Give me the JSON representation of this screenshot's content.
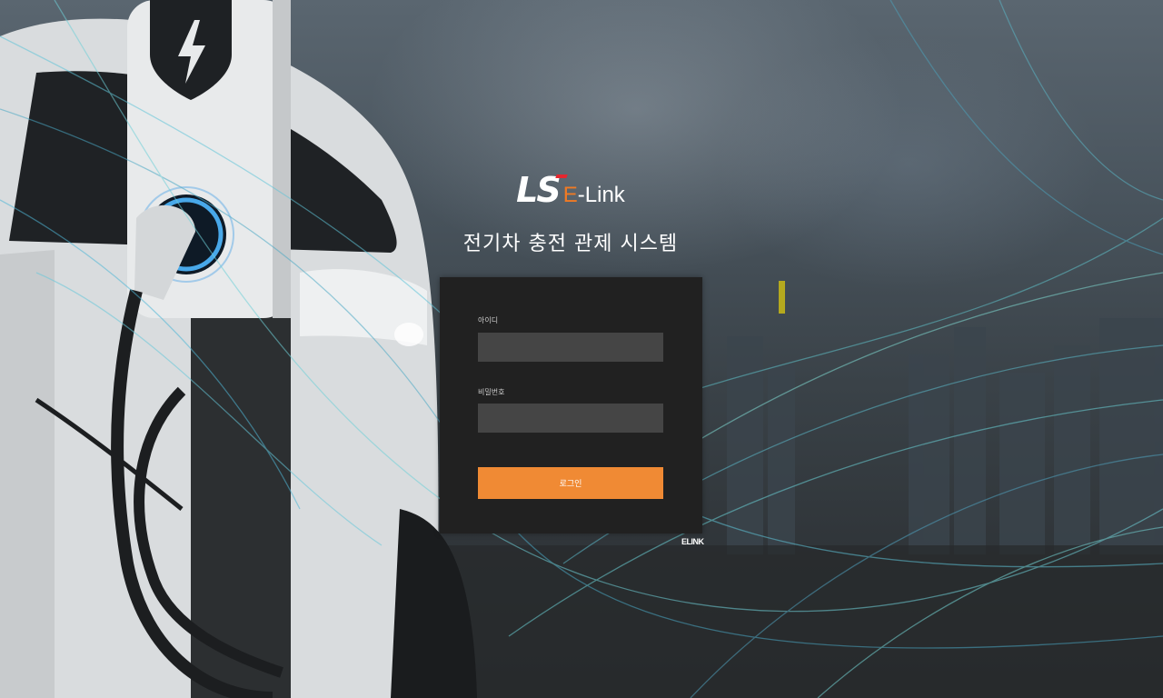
{
  "brand": {
    "logo_ls": "LS",
    "logo_e": "E",
    "logo_link": "-Link",
    "system_title": "전기차 충전 관제 시스템"
  },
  "login": {
    "id_label": "아이디",
    "id_value": "",
    "password_label": "비밀번호",
    "password_value": "",
    "submit_label": "로그인"
  },
  "footer": {
    "corner_mark": "ELINK"
  },
  "colors": {
    "accent": "#f08a34",
    "panel": "#212121",
    "input": "#454545",
    "logo_red": "#e6262e",
    "logo_orange": "#f07a24"
  },
  "icons": [
    "lightning-bolt-icon"
  ]
}
